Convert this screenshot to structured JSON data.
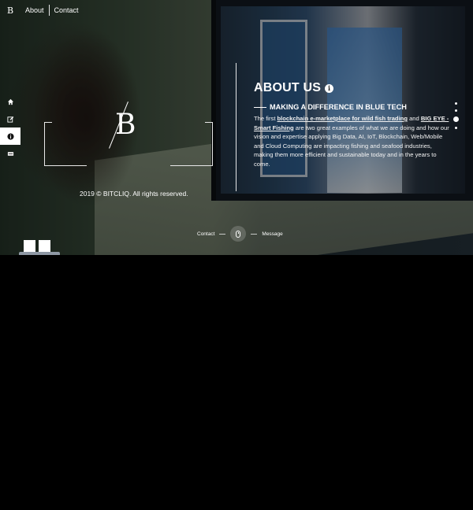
{
  "nav": {
    "brand_mark": "B",
    "about": "About",
    "contact": "Contact"
  },
  "rail": {
    "items": [
      {
        "icon": "home-icon"
      },
      {
        "icon": "edit-icon"
      },
      {
        "icon": "info-icon",
        "active": true
      },
      {
        "icon": "mail-icon"
      }
    ]
  },
  "logo": {
    "letter": "B"
  },
  "footer": {
    "copyright": "2019 © BITCLIQ. All rights reserved."
  },
  "about": {
    "title": "ABOUT US",
    "info_glyph": "i",
    "subtitle": "MAKING A DIFFERENCE IN BLUE TECH",
    "p_intro": "The first ",
    "link1": "blockchain e-marketplace for wild fish trading",
    "p_and": " and ",
    "link2": "BIG EYE - Smart Fishing",
    "p_rest": " are two great examples of what we are doing and how our vision and expertise applying Big Data, AI, IoT, Blockchain, Web/Mobile and Cloud Computing are impacting fishing and seafood industries, making them more efficient and sustainable today and in the years to come."
  },
  "bottom_nav": {
    "contact": "Contact",
    "message": "Message"
  },
  "colors": {
    "background": "#000000",
    "text": "#ffffff",
    "active_rail": "#ffffff"
  }
}
